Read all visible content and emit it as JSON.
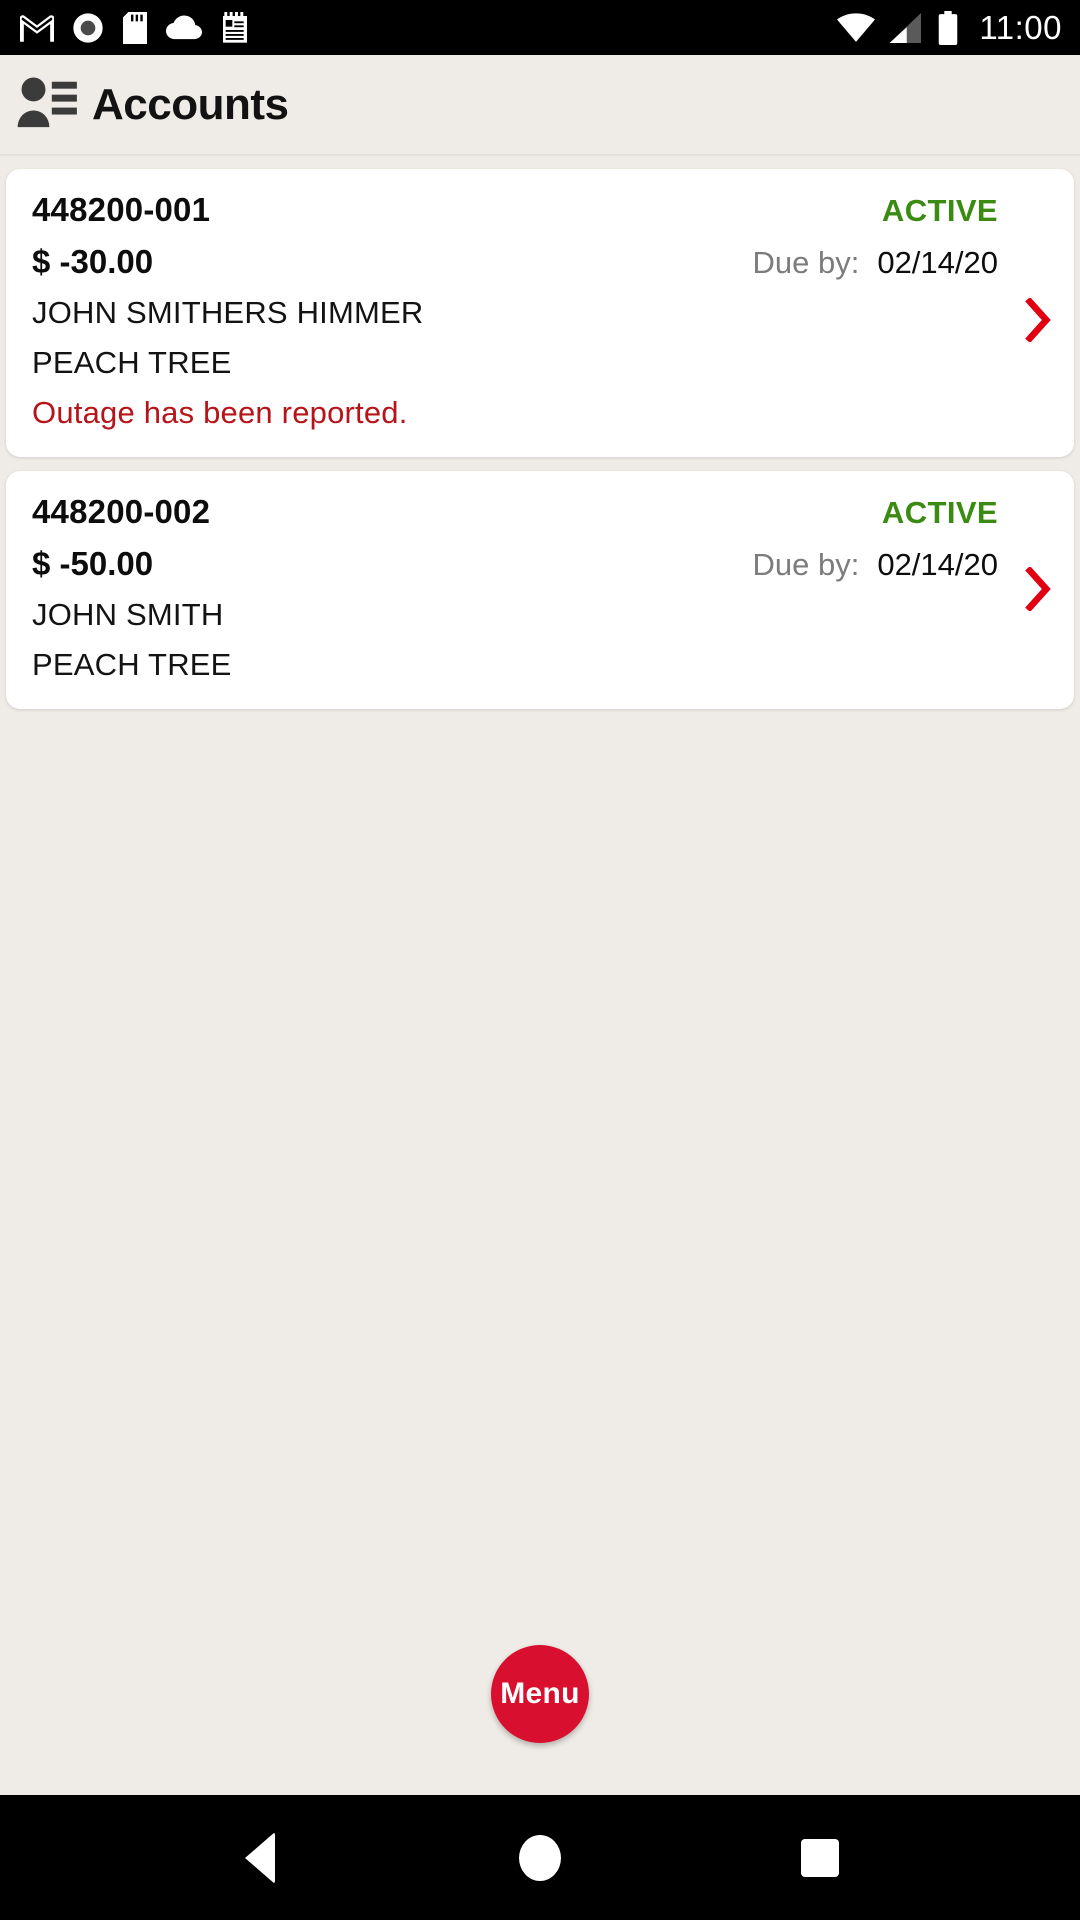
{
  "status_bar": {
    "icons_left": [
      "gmail-icon",
      "record-circle-icon",
      "sd-card-icon",
      "cloud-icon",
      "notes-icon"
    ],
    "icons_right": [
      "wifi-icon",
      "cellular-signal-icon",
      "battery-icon"
    ],
    "time": "11:00"
  },
  "header": {
    "icon": "contacts-icon",
    "title": "Accounts"
  },
  "accounts": [
    {
      "account_number": "448200-001",
      "status": "ACTIVE",
      "amount": "$ -30.00",
      "due_label": "Due by:",
      "due_date": "02/14/20",
      "customer_name": "JOHN SMITHERS HIMMER",
      "location": "PEACH TREE",
      "notice": "Outage has been reported.",
      "chevron": "chevron-right-icon"
    },
    {
      "account_number": "448200-002",
      "status": "ACTIVE",
      "amount": "$ -50.00",
      "due_label": "Due by:",
      "due_date": "02/14/20",
      "customer_name": "JOHN SMITH",
      "location": "PEACH TREE",
      "notice": "",
      "chevron": "chevron-right-icon"
    }
  ],
  "fab": {
    "label": "Menu"
  },
  "nav_bar": {
    "back": "back-triangle-icon",
    "home": "home-circle-icon",
    "recents": "recents-square-icon"
  },
  "colors": {
    "background": "#efebe6",
    "card": "#ffffff",
    "status_active": "#3b8b12",
    "notice_red": "#b7141a",
    "accent_red": "#d80f2e",
    "chevron_red": "#e00012",
    "muted_text": "#7c7c7c"
  }
}
